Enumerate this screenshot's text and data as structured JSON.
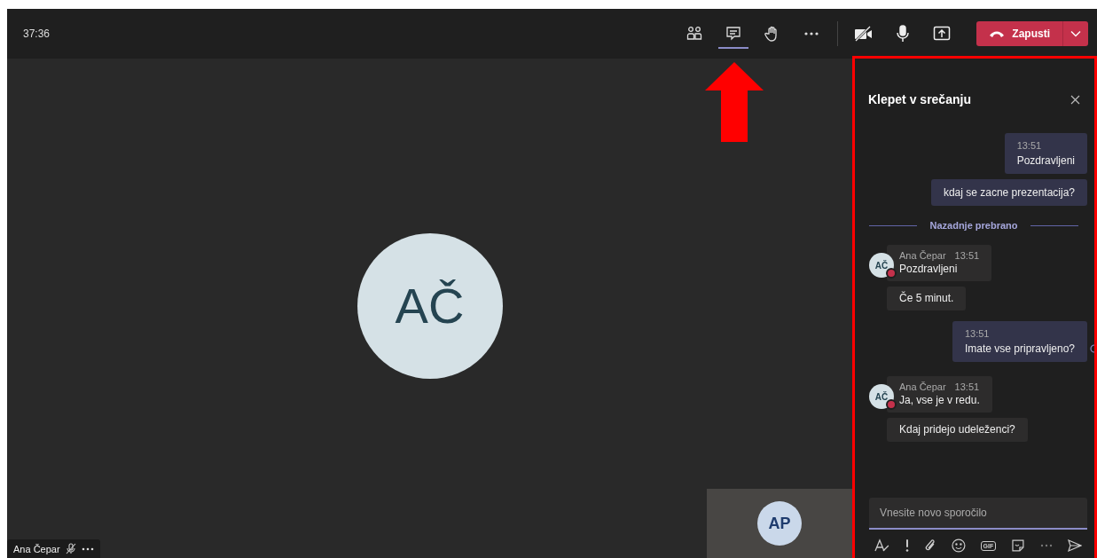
{
  "top_bar": {
    "timer": "37:36",
    "toolbar": [
      {
        "kind": "people",
        "selected": false
      },
      {
        "kind": "chat",
        "selected": true
      },
      {
        "kind": "hand",
        "selected": false
      },
      {
        "kind": "more",
        "selected": false
      }
    ],
    "devices": [
      {
        "kind": "camera-off"
      },
      {
        "kind": "mic"
      },
      {
        "kind": "share"
      }
    ],
    "leave_button": {
      "label": "Zapusti"
    }
  },
  "stage": {
    "participant": {
      "initials": "AČ",
      "name": "Ana Čepar",
      "muted": true
    },
    "self_tile": {
      "initials": "AP"
    }
  },
  "chat": {
    "title": "Klepet v srečanju",
    "messages": [
      {
        "kind": "sent",
        "time": "13:51",
        "text": "Pozdravljeni",
        "read_receipt": false
      },
      {
        "kind": "sent",
        "text": "kdaj se zacne prezentacija?",
        "read_receipt": false
      },
      {
        "kind": "divider",
        "text": "Nazadnje prebrano"
      },
      {
        "kind": "received",
        "initials": "AČ",
        "author": "Ana Čepar",
        "time": "13:51",
        "text": "Pozdravljeni"
      },
      {
        "kind": "received",
        "text": "Če 5 minut."
      },
      {
        "kind": "sent",
        "time": "13:51",
        "text": "Imate vse pripravljeno?",
        "read_receipt": true
      },
      {
        "kind": "received",
        "initials": "AČ",
        "author": "Ana Čepar",
        "time": "13:51",
        "text": "Ja, vse je v redu."
      },
      {
        "kind": "received",
        "text": "Kdaj pridejo udeleženci?"
      }
    ],
    "compose": {
      "placeholder": "Vnesite novo sporočilo",
      "tools": [
        {
          "kind": "format"
        },
        {
          "kind": "important"
        },
        {
          "kind": "attach"
        },
        {
          "kind": "emoji"
        },
        {
          "kind": "gif",
          "label": "GIF"
        },
        {
          "kind": "sticker"
        },
        {
          "kind": "more"
        },
        {
          "kind": "send"
        }
      ]
    }
  }
}
